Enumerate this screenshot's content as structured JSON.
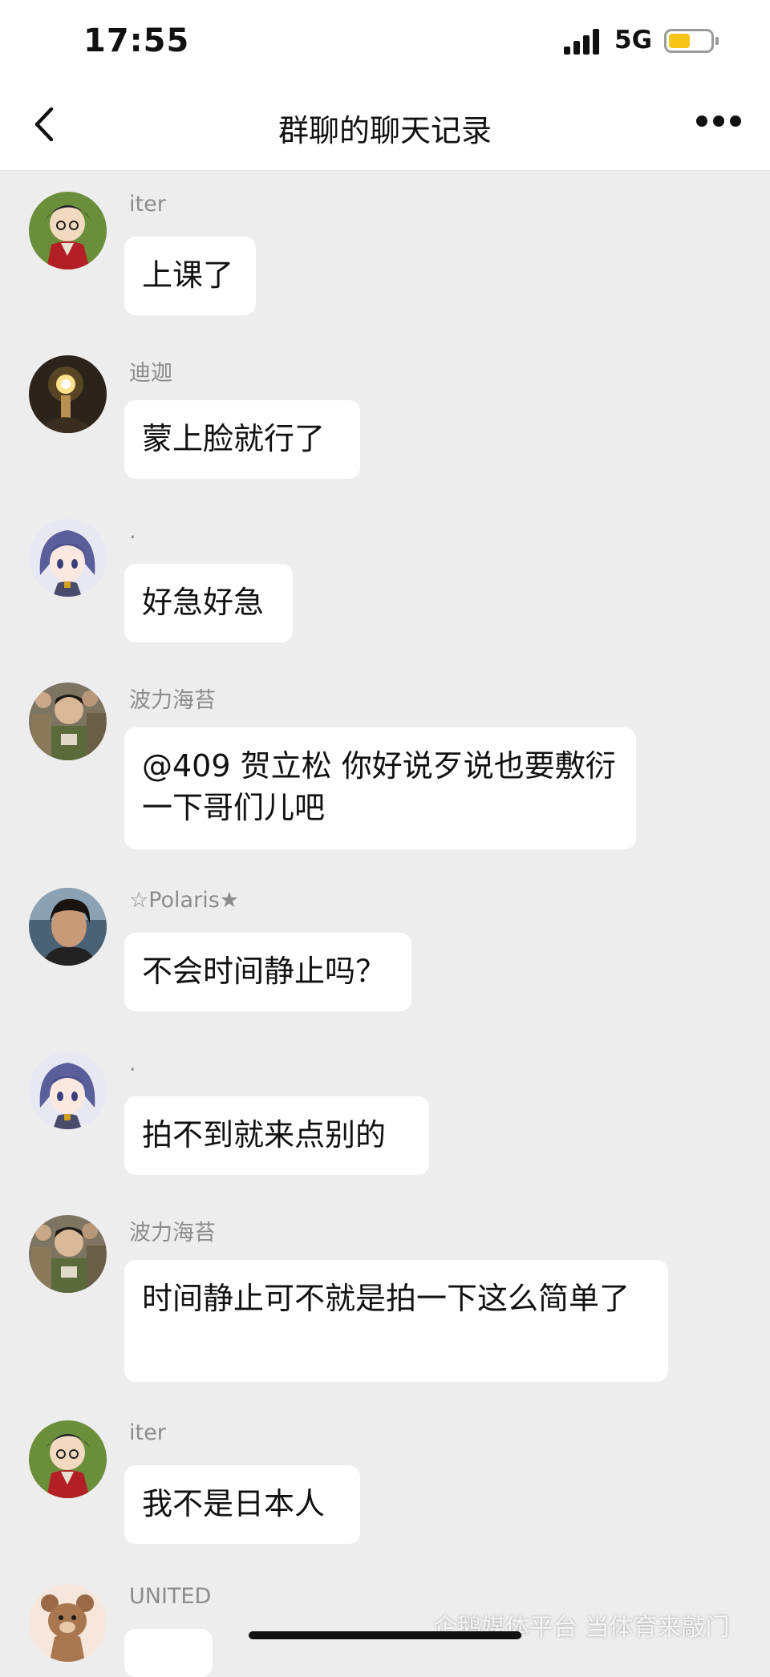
{
  "status_bar": {
    "time": "17:55",
    "network": "5G"
  },
  "nav": {
    "title": "群聊的聊天记录"
  },
  "messages": [
    {
      "sender": "iter",
      "text": "上课了",
      "avatar": "anime-detective-avatar"
    },
    {
      "sender": "迪迦",
      "text": "蒙上脸就行了",
      "avatar": "glowing-light-avatar"
    },
    {
      "sender": ".",
      "text": "好急好急",
      "avatar": "anime-girl-avatar"
    },
    {
      "sender": "波力海苔",
      "text": "@409 贺立松 你好说歹说也要敷衍一下哥们儿吧",
      "avatar": "crowd-photo-avatar"
    },
    {
      "sender": "☆Polaris★",
      "text": "不会时间静止吗？",
      "avatar": "person-photo-avatar"
    },
    {
      "sender": ".",
      "text": "拍不到就来点别的",
      "avatar": "anime-girl-avatar"
    },
    {
      "sender": "波力海苔",
      "text": "时间静止可不就是拍一下这么简单了",
      "avatar": "crowd-photo-avatar"
    },
    {
      "sender": "iter",
      "text": "我不是日本人",
      "avatar": "anime-detective-avatar"
    },
    {
      "sender": "UNITED",
      "text": "",
      "avatar": "bear-avatar"
    }
  ],
  "watermark": "企鹅媒体平台 当体育来敲门"
}
